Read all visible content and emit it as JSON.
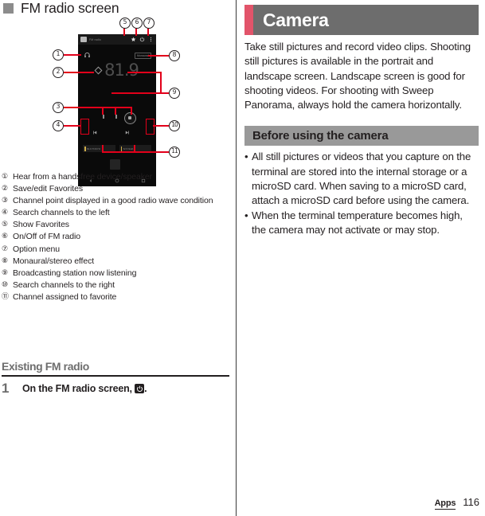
{
  "left": {
    "section_heading": "FM radio screen",
    "figure": {
      "phone_screen": {
        "app_name": "FM radio",
        "frequency": "81.9",
        "mono_badge": "Monaural",
        "favorite_chips": [
          {
            "label": "81.9 TOKYO"
          },
          {
            "label": "82.5 NHK"
          }
        ],
        "icons": {
          "headphone": "headphone-icon",
          "favorites": "favorites-icon",
          "power": "power-icon",
          "overflow": "overflow-menu-icon",
          "prev": "previous-icon",
          "next": "next-icon",
          "nav_back": "nav-back-icon",
          "nav_home": "nav-home-icon",
          "nav_recents": "nav-recents-icon"
        }
      },
      "callout_numbers": [
        "1",
        "2",
        "3",
        "4",
        "5",
        "6",
        "7",
        "8",
        "9",
        "10",
        "11"
      ],
      "callout_color": "#e2001a"
    },
    "legend": [
      {
        "num": "①",
        "text": "Hear from a handsfree device/speaker"
      },
      {
        "num": "②",
        "text": "Save/edit Favorites"
      },
      {
        "num": "③",
        "text": "Channel point displayed in a good radio wave condition"
      },
      {
        "num": "④",
        "text": "Search channels to the left"
      },
      {
        "num": "⑤",
        "text": "Show Favorites"
      },
      {
        "num": "⑥",
        "text": "On/Off of FM radio"
      },
      {
        "num": "⑦",
        "text": "Option menu"
      },
      {
        "num": "⑧",
        "text": "Monaural/stereo effect"
      },
      {
        "num": "⑨",
        "text": "Broadcasting station now listening"
      },
      {
        "num": "⑩",
        "text": "Search channels to the right"
      },
      {
        "num": "⑪",
        "text": "Channel assigned to favorite"
      }
    ],
    "sub_heading": "Existing FM radio",
    "step": {
      "number": "1",
      "text_before": "On the FM radio screen, ",
      "icon": "power-icon",
      "text_after": "."
    }
  },
  "right": {
    "chapter_title": "Camera",
    "chapter_accent_color": "#e2546a",
    "chapter_bar_color": "#6d6d6d",
    "intro_paragraph": "Take still pictures and record video clips. Shooting still pictures is available in the portrait and landscape screen. Landscape screen is good for shooting videos. For shooting with Sweep Panorama, always hold the camera horizontally.",
    "sub_bar_title": "Before using the camera",
    "bullets": [
      "All still pictures or videos that you capture on the terminal are stored into the internal storage or a microSD card. When saving to a microSD card, attach a microSD card before using the camera.",
      "When the terminal temperature becomes high, the camera may not activate or may stop."
    ],
    "bullet_marker": "•"
  },
  "footer": {
    "section": "Apps",
    "page": "116"
  }
}
